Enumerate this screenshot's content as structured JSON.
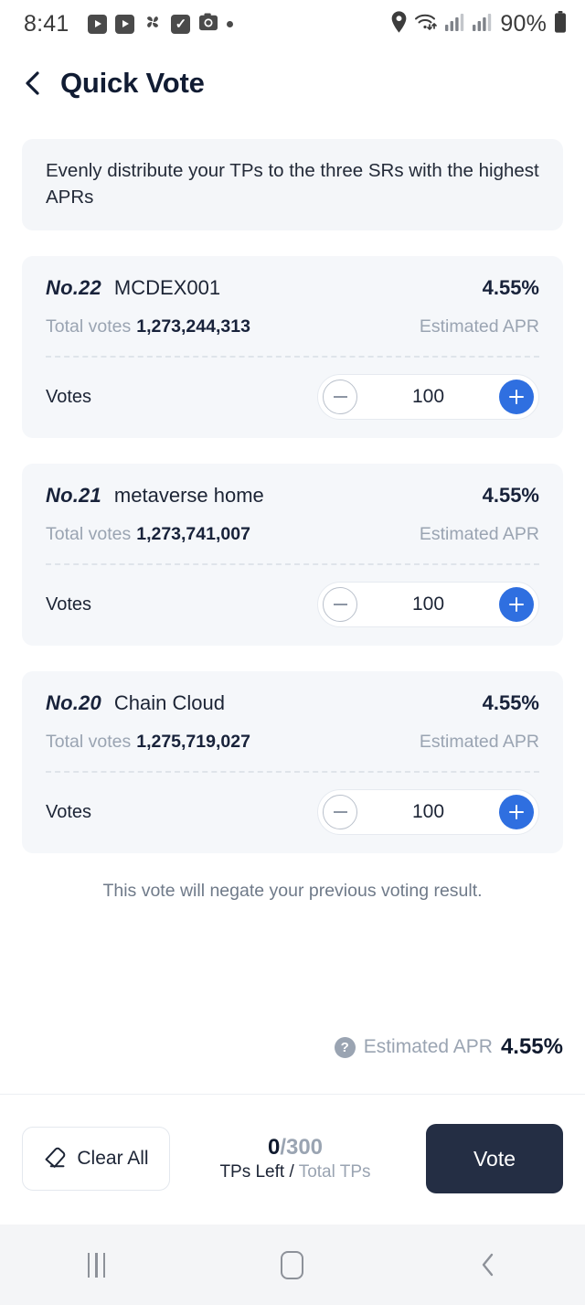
{
  "status_bar": {
    "time": "8:41",
    "battery_percent": "90%",
    "left_icons": [
      "video-play-icon",
      "video-play-icon",
      "pinwheel-icon",
      "checkbox-icon",
      "camera-icon",
      "dot-icon"
    ],
    "right_icons": [
      "location-pin-icon",
      "wifi-icon",
      "signal-bars-icon",
      "signal-bars-icon",
      "battery-icon"
    ]
  },
  "header": {
    "back_icon": "chevron-left-icon",
    "title": "Quick Vote"
  },
  "banner": {
    "text": "Evenly distribute your TPs to the three SRs with the highest APRs"
  },
  "cards": [
    {
      "rank": "No.22",
      "name": "MCDEX001",
      "apr": "4.55%",
      "total_votes_label": "Total votes",
      "total_votes": "1,273,244,313",
      "apr_label": "Estimated APR",
      "votes_label": "Votes",
      "votes_value": "100"
    },
    {
      "rank": "No.21",
      "name": "metaverse home",
      "apr": "4.55%",
      "total_votes_label": "Total votes",
      "total_votes": "1,273,741,007",
      "apr_label": "Estimated APR",
      "votes_label": "Votes",
      "votes_value": "100"
    },
    {
      "rank": "No.20",
      "name": "Chain Cloud",
      "apr": "4.55%",
      "total_votes_label": "Total votes",
      "total_votes": "1,275,719,027",
      "apr_label": "Estimated APR",
      "votes_label": "Votes",
      "votes_value": "100"
    }
  ],
  "note": {
    "text": "This vote will negate your previous voting result."
  },
  "apr_summary": {
    "help_icon": "question-mark-icon",
    "label": "Estimated APR",
    "value": "4.55%"
  },
  "bottom_bar": {
    "clear_icon": "eraser-icon",
    "clear_label": "Clear All",
    "tps_left": "0",
    "tps_total": "/300",
    "caption_left": "TPs Left",
    "caption_sep": " / ",
    "caption_right": "Total TPs",
    "vote_label": "Vote"
  },
  "nav_bar": {
    "recents_icon": "recents-icon",
    "home_icon": "home-icon",
    "back_icon": "back-chevron-icon"
  },
  "colors": {
    "accent_blue": "#2f6fe0",
    "dark_navy": "#242e44",
    "muted_gray": "#9aa4b2",
    "card_bg": "#f5f7fa"
  }
}
